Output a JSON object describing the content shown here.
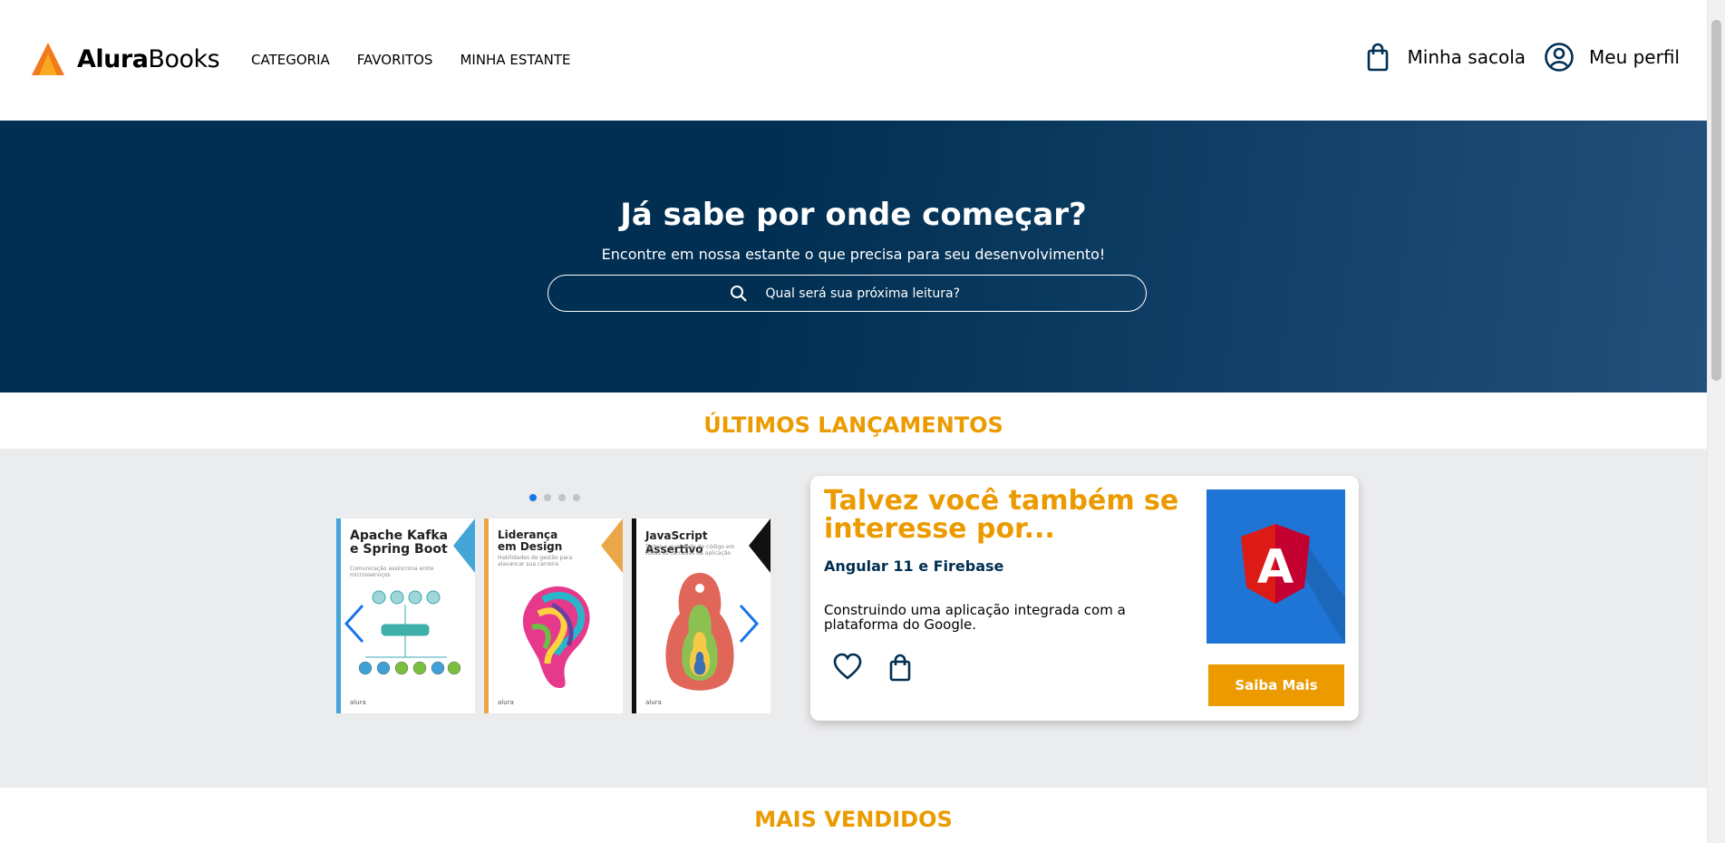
{
  "brand": {
    "name_part1": "Alura",
    "name_part2": "Books"
  },
  "nav": {
    "items": [
      "CATEGORIA",
      "FAVORITOS",
      "MINHA ESTANTE"
    ]
  },
  "user": {
    "bag_label": "Minha sacola",
    "profile_label": "Meu perfil"
  },
  "hero": {
    "title": "Já sabe por onde começar?",
    "subtitle": "Encontre em nossa estante o que precisa para seu desenvolvimento!",
    "search_placeholder": "Qual será sua próxima leitura?"
  },
  "releases": {
    "title": "ÚLTIMOS LANÇAMENTOS",
    "books": [
      {
        "title": "Apache Kafka e Spring Boot",
        "subtitle": "Comunicação assíncrona entre microsserviços",
        "color": "#44a5d9"
      },
      {
        "title": "Liderança em Design",
        "subtitle": "Habilidades de gestão para alavancar sua carreira",
        "color": "#eba64a"
      },
      {
        "title": "JavaScript Assertivo",
        "subtitle": "Testes e qualidade de código em todas as camadas da aplicação",
        "color": "#111111"
      }
    ],
    "book_footer": "alura",
    "carousel_dots": 4,
    "active_dot": 0
  },
  "recommendation": {
    "heading": "Talvez você também se interesse por...",
    "book_title": "Angular 11 e Firebase",
    "description": "Construindo uma aplicação integrada com a plataforma do Google.",
    "button_label": "Saiba Mais",
    "cover_letter": "A"
  },
  "bestsellers": {
    "title": "MAIS VENDIDOS"
  },
  "colors": {
    "primary": "#002f52",
    "accent": "#eb9b00",
    "link": "#1875e8"
  }
}
